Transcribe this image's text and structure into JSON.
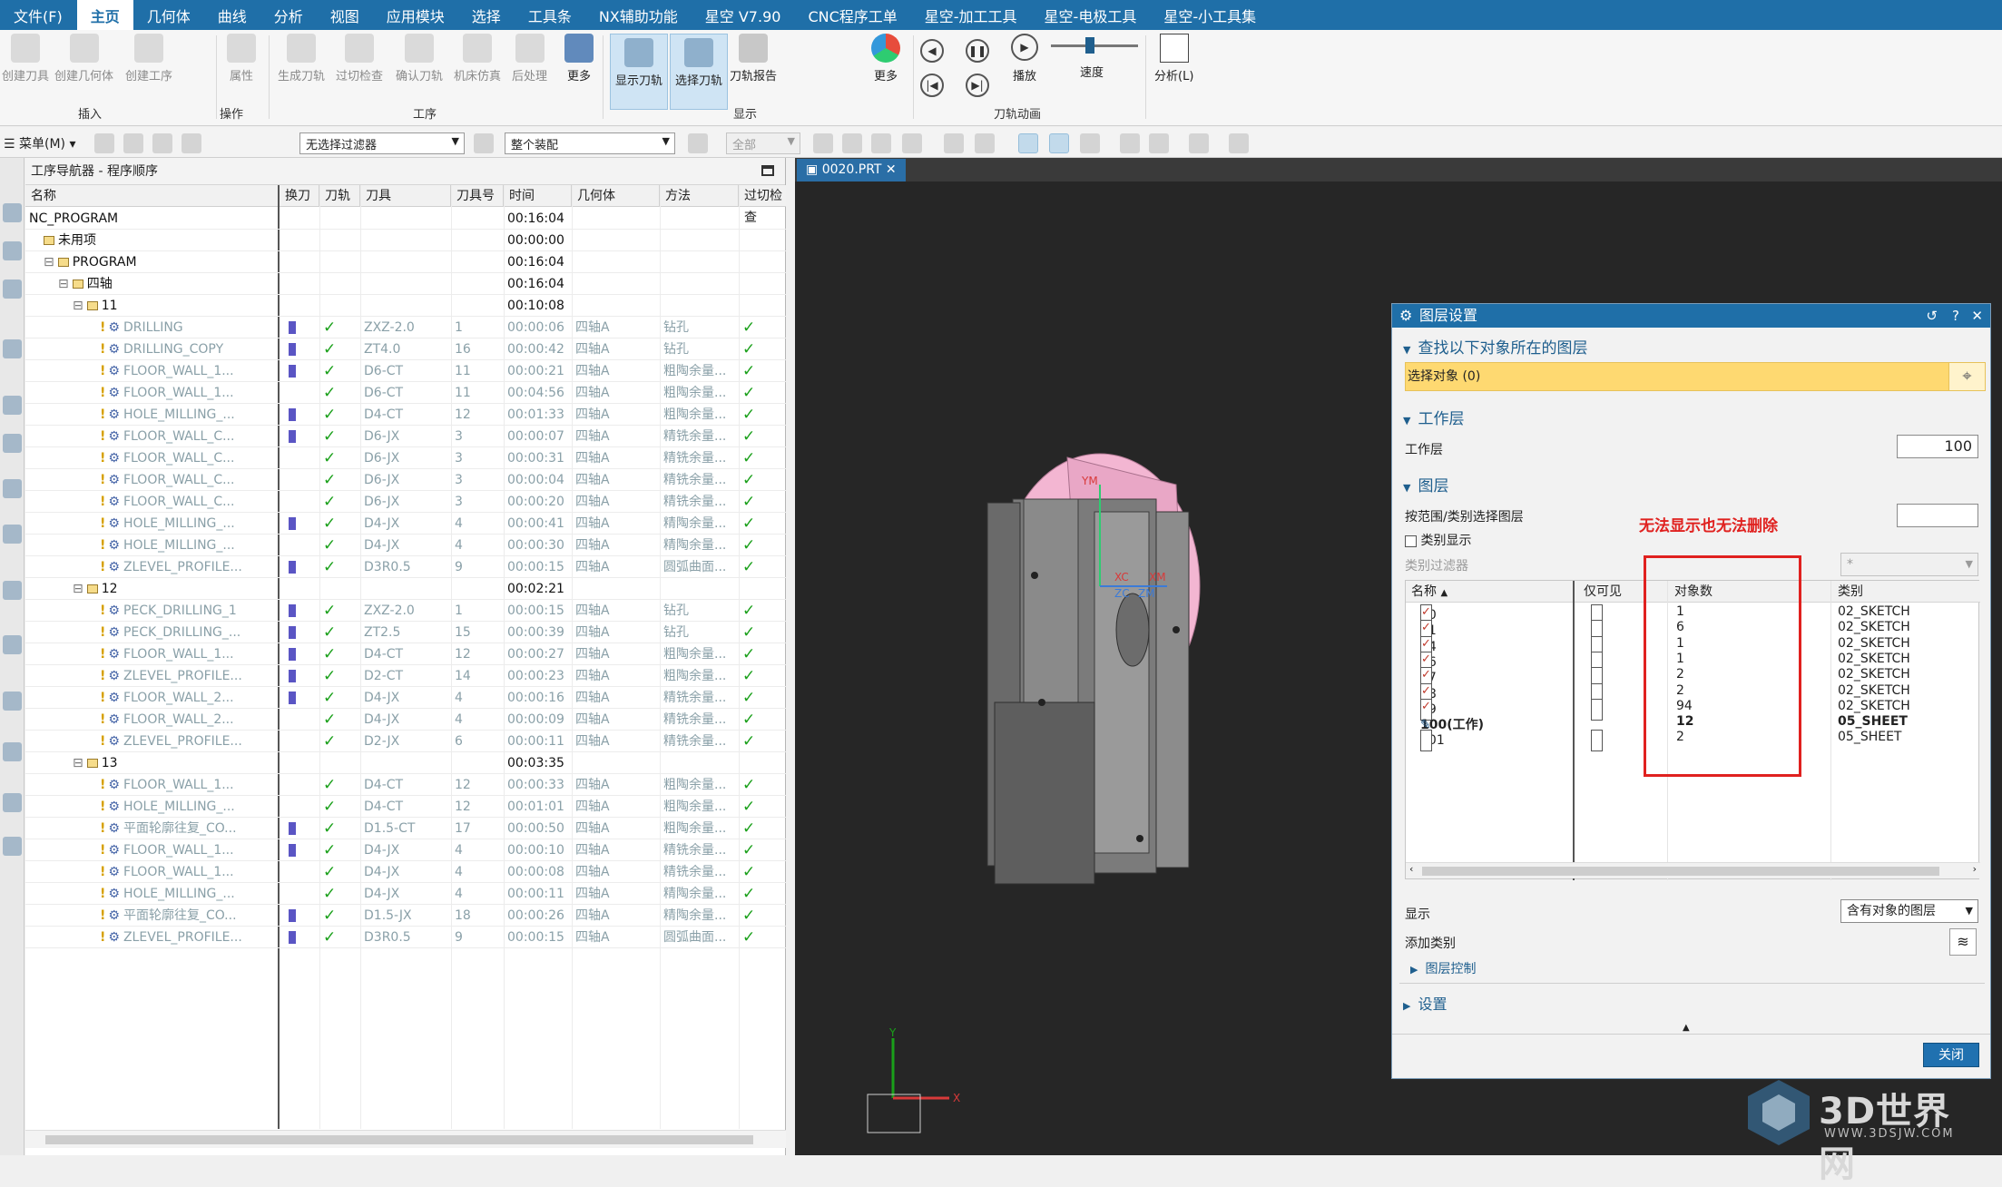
{
  "menubar": {
    "items": [
      "文件(F)",
      "主页",
      "几何体",
      "曲线",
      "分析",
      "视图",
      "应用模块",
      "选择",
      "工具条",
      "NX辅助功能",
      "星空 V7.90",
      "CNC程序工单",
      "星空-加工工具",
      "星空-电极工具",
      "星空-小工具集"
    ],
    "active_index": 1
  },
  "ribbon": {
    "insert_items": [
      "创建刀具",
      "创建几何体",
      "创建工序"
    ],
    "attr_item": "属性",
    "op_items": [
      "生成刀轨",
      "过切检查",
      "确认刀轨",
      "机床仿真",
      "后处理"
    ],
    "more1": "更多",
    "display_items": [
      "显示刀轨",
      "选择刀轨",
      "刀轨报告"
    ],
    "more2": "更多",
    "play": "播放",
    "speed": "速度",
    "analyze": "分析(L)",
    "group_insert": "插入",
    "group_ops": "操作",
    "group_process": "工序",
    "group_display": "显示",
    "group_anim": "刀轨动画"
  },
  "toolbar2": {
    "menu": "菜单(M)",
    "filter": "无选择过滤器",
    "assembly": "整个装配",
    "all": "全部"
  },
  "navigator": {
    "title": "工序导航器 - 程序顺序",
    "columns": [
      "名称",
      "换刀",
      "刀轨",
      "刀具",
      "刀具号",
      "时间",
      "几何体",
      "方法",
      "过切检查"
    ],
    "rows": [
      {
        "kind": "grp",
        "indent": 0,
        "name": "NC_PROGRAM",
        "time": "00:16:04"
      },
      {
        "kind": "grp",
        "indent": 1,
        "name": "未用项",
        "time": "00:00:00",
        "folder": true
      },
      {
        "kind": "grp",
        "indent": 1,
        "name": "PROGRAM",
        "time": "00:16:04",
        "folder": true,
        "tw": "−"
      },
      {
        "kind": "grp",
        "indent": 2,
        "name": "四轴",
        "time": "00:16:04",
        "folder": true,
        "tw": "−"
      },
      {
        "kind": "grp",
        "indent": 3,
        "name": "11",
        "time": "00:10:08",
        "folder": true,
        "tw": "−"
      },
      {
        "kind": "op",
        "name": "DRILLING",
        "swap": true,
        "tool": "ZXZ-2.0",
        "num": "1",
        "time": "00:00:06",
        "geom": "四轴A",
        "meth": "钻孔"
      },
      {
        "kind": "op",
        "name": "DRILLING_COPY",
        "swap": true,
        "tool": "ZT4.0",
        "num": "16",
        "time": "00:00:42",
        "geom": "四轴A",
        "meth": "钻孔"
      },
      {
        "kind": "op",
        "name": "FLOOR_WALL_1...",
        "swap": true,
        "tool": "D6-CT",
        "num": "11",
        "time": "00:00:21",
        "geom": "四轴A",
        "meth": "粗陶余量..."
      },
      {
        "kind": "op",
        "name": "FLOOR_WALL_1...",
        "swap": false,
        "tool": "D6-CT",
        "num": "11",
        "time": "00:04:56",
        "geom": "四轴A",
        "meth": "粗陶余量..."
      },
      {
        "kind": "op",
        "name": "HOLE_MILLING_...",
        "swap": true,
        "tool": "D4-CT",
        "num": "12",
        "time": "00:01:33",
        "geom": "四轴A",
        "meth": "粗陶余量..."
      },
      {
        "kind": "op",
        "name": "FLOOR_WALL_C...",
        "swap": true,
        "tool": "D6-JX",
        "num": "3",
        "time": "00:00:07",
        "geom": "四轴A",
        "meth": "精铣余量..."
      },
      {
        "kind": "op",
        "name": "FLOOR_WALL_C...",
        "swap": false,
        "tool": "D6-JX",
        "num": "3",
        "time": "00:00:31",
        "geom": "四轴A",
        "meth": "精铣余量..."
      },
      {
        "kind": "op",
        "name": "FLOOR_WALL_C...",
        "swap": false,
        "tool": "D6-JX",
        "num": "3",
        "time": "00:00:04",
        "geom": "四轴A",
        "meth": "精铣余量..."
      },
      {
        "kind": "op",
        "name": "FLOOR_WALL_C...",
        "swap": false,
        "tool": "D6-JX",
        "num": "3",
        "time": "00:00:20",
        "geom": "四轴A",
        "meth": "精铣余量..."
      },
      {
        "kind": "op",
        "name": "HOLE_MILLING_...",
        "swap": true,
        "tool": "D4-JX",
        "num": "4",
        "time": "00:00:41",
        "geom": "四轴A",
        "meth": "精陶余量..."
      },
      {
        "kind": "op",
        "name": "HOLE_MILLING_...",
        "swap": false,
        "tool": "D4-JX",
        "num": "4",
        "time": "00:00:30",
        "geom": "四轴A",
        "meth": "精陶余量..."
      },
      {
        "kind": "op",
        "name": "ZLEVEL_PROFILE...",
        "swap": true,
        "tool": "D3R0.5",
        "num": "9",
        "time": "00:00:15",
        "geom": "四轴A",
        "meth": "圆弧曲面..."
      },
      {
        "kind": "grp",
        "indent": 3,
        "name": "12",
        "time": "00:02:21",
        "folder": true,
        "tw": "−"
      },
      {
        "kind": "op",
        "name": "PECK_DRILLING_1",
        "swap": true,
        "tool": "ZXZ-2.0",
        "num": "1",
        "time": "00:00:15",
        "geom": "四轴A",
        "meth": "钻孔"
      },
      {
        "kind": "op",
        "name": "PECK_DRILLING_...",
        "swap": true,
        "tool": "ZT2.5",
        "num": "15",
        "time": "00:00:39",
        "geom": "四轴A",
        "meth": "钻孔"
      },
      {
        "kind": "op",
        "name": "FLOOR_WALL_1...",
        "swap": true,
        "tool": "D4-CT",
        "num": "12",
        "time": "00:00:27",
        "geom": "四轴A",
        "meth": "粗陶余量..."
      },
      {
        "kind": "op",
        "name": "ZLEVEL_PROFILE...",
        "swap": true,
        "tool": "D2-CT",
        "num": "14",
        "time": "00:00:23",
        "geom": "四轴A",
        "meth": "粗陶余量..."
      },
      {
        "kind": "op",
        "name": "FLOOR_WALL_2...",
        "swap": true,
        "tool": "D4-JX",
        "num": "4",
        "time": "00:00:16",
        "geom": "四轴A",
        "meth": "精铣余量..."
      },
      {
        "kind": "op",
        "name": "FLOOR_WALL_2...",
        "swap": false,
        "tool": "D4-JX",
        "num": "4",
        "time": "00:00:09",
        "geom": "四轴A",
        "meth": "精铣余量..."
      },
      {
        "kind": "op",
        "name": "ZLEVEL_PROFILE...",
        "swap": false,
        "tool": "D2-JX",
        "num": "6",
        "time": "00:00:11",
        "geom": "四轴A",
        "meth": "精铣余量..."
      },
      {
        "kind": "grp",
        "indent": 3,
        "name": "13",
        "time": "00:03:35",
        "folder": true,
        "tw": "−"
      },
      {
        "kind": "op",
        "name": "FLOOR_WALL_1...",
        "swap": false,
        "tool": "D4-CT",
        "num": "12",
        "time": "00:00:33",
        "geom": "四轴A",
        "meth": "粗陶余量..."
      },
      {
        "kind": "op",
        "name": "HOLE_MILLING_...",
        "swap": false,
        "tool": "D4-CT",
        "num": "12",
        "time": "00:01:01",
        "geom": "四轴A",
        "meth": "粗陶余量..."
      },
      {
        "kind": "op",
        "name": "平面轮廓往复_CO...",
        "swap": true,
        "tool": "D1.5-CT",
        "num": "17",
        "time": "00:00:50",
        "geom": "四轴A",
        "meth": "粗陶余量..."
      },
      {
        "kind": "op",
        "name": "FLOOR_WALL_1...",
        "swap": true,
        "tool": "D4-JX",
        "num": "4",
        "time": "00:00:10",
        "geom": "四轴A",
        "meth": "精铣余量..."
      },
      {
        "kind": "op",
        "name": "FLOOR_WALL_1...",
        "swap": false,
        "tool": "D4-JX",
        "num": "4",
        "time": "00:00:08",
        "geom": "四轴A",
        "meth": "精铣余量..."
      },
      {
        "kind": "op",
        "name": "HOLE_MILLING_...",
        "swap": false,
        "tool": "D4-JX",
        "num": "4",
        "time": "00:00:11",
        "geom": "四轴A",
        "meth": "精陶余量..."
      },
      {
        "kind": "op",
        "name": "平面轮廓往复_CO...",
        "swap": true,
        "tool": "D1.5-JX",
        "num": "18",
        "time": "00:00:26",
        "geom": "四轴A",
        "meth": "精陶余量..."
      },
      {
        "kind": "op",
        "name": "ZLEVEL_PROFILE...",
        "swap": true,
        "tool": "D3R0.5",
        "num": "9",
        "time": "00:00:15",
        "geom": "四轴A",
        "meth": "圆弧曲面..."
      }
    ]
  },
  "viewport": {
    "tab": "0020.PRT",
    "axis_labels": {
      "ym": "YM",
      "xc": "XC",
      "xm": "XM",
      "zc": "ZC",
      "zm": "ZM",
      "y": "Y",
      "x": "X"
    }
  },
  "dialog": {
    "title": "图层设置",
    "sec_find": "查找以下对象所在的图层",
    "select_objects": "选择对象 (0)",
    "sec_work": "工作层",
    "work_label": "工作层",
    "work_value": "100",
    "sec_layers": "图层",
    "range_label": "按范围/类别选择图层",
    "category_display": "类别显示",
    "category_filter": "类别过滤器",
    "category_filter_value": "*",
    "table_columns": [
      "名称",
      "仅可见",
      "对象数",
      "类别"
    ],
    "layers": [
      {
        "name": "50",
        "checked": true,
        "count": "1",
        "category": "02_SKETCH"
      },
      {
        "name": "51",
        "checked": true,
        "count": "6",
        "category": "02_SKETCH"
      },
      {
        "name": "54",
        "checked": true,
        "count": "1",
        "category": "02_SKETCH"
      },
      {
        "name": "56",
        "checked": true,
        "count": "1",
        "category": "02_SKETCH"
      },
      {
        "name": "57",
        "checked": true,
        "count": "2",
        "category": "02_SKETCH"
      },
      {
        "name": "58",
        "checked": true,
        "count": "2",
        "category": "02_SKETCH"
      },
      {
        "name": "59",
        "checked": true,
        "count": "94",
        "category": "02_SKETCH"
      },
      {
        "name": "100(工作)",
        "work": true,
        "count": "12",
        "category": "05_SHEET"
      },
      {
        "name": "101",
        "checked": false,
        "count": "2",
        "category": "05_SHEET"
      }
    ],
    "display_label": "显示",
    "display_value": "含有对象的图层",
    "add_category": "添加类别",
    "layer_control": "图层控制",
    "settings": "设置",
    "close": "关闭"
  },
  "annotation": "无法显示也无法删除",
  "watermark": {
    "brand": "3D世界网",
    "url": "WWW.3DSJW.COM"
  }
}
